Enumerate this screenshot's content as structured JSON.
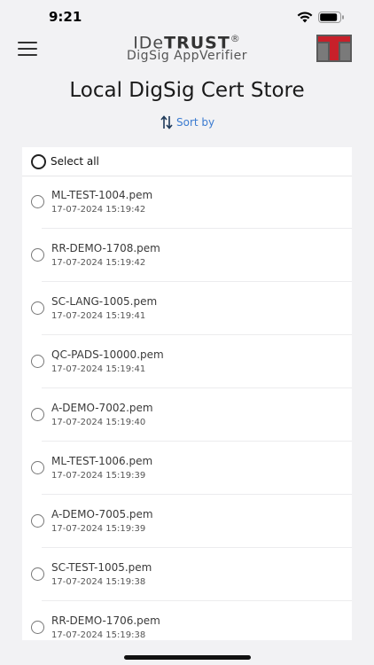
{
  "status_bar": {
    "time": "9:21"
  },
  "header": {
    "brand_prefix": "IDe",
    "brand_main": "TRUST",
    "brand_mark": "®",
    "brand_sub": "DigSig AppVerifier",
    "menu_icon": "hamburger-menu-icon",
    "logo": "company-logo"
  },
  "page": {
    "title": "Local DigSig Cert Store"
  },
  "sort": {
    "label": "Sort by",
    "icon": "sort-arrows-icon"
  },
  "colors": {
    "accent": "#3b7bd0",
    "logo_red": "#c8202a",
    "logo_gray": "#5a5a5a"
  },
  "list": {
    "select_all_label": "Select all",
    "items": [
      {
        "name": "ML-TEST-1004.pem",
        "date": "17-07-2024 15:19:42"
      },
      {
        "name": "RR-DEMO-1708.pem",
        "date": "17-07-2024 15:19:42"
      },
      {
        "name": "SC-LANG-1005.pem",
        "date": "17-07-2024 15:19:41"
      },
      {
        "name": "QC-PADS-10000.pem",
        "date": "17-07-2024 15:19:41"
      },
      {
        "name": "A-DEMO-7002.pem",
        "date": "17-07-2024 15:19:40"
      },
      {
        "name": "ML-TEST-1006.pem",
        "date": "17-07-2024 15:19:39"
      },
      {
        "name": "A-DEMO-7005.pem",
        "date": "17-07-2024 15:19:39"
      },
      {
        "name": "SC-TEST-1005.pem",
        "date": "17-07-2024 15:19:38"
      },
      {
        "name": "RR-DEMO-1706.pem",
        "date": "17-07-2024 15:19:38"
      }
    ]
  }
}
